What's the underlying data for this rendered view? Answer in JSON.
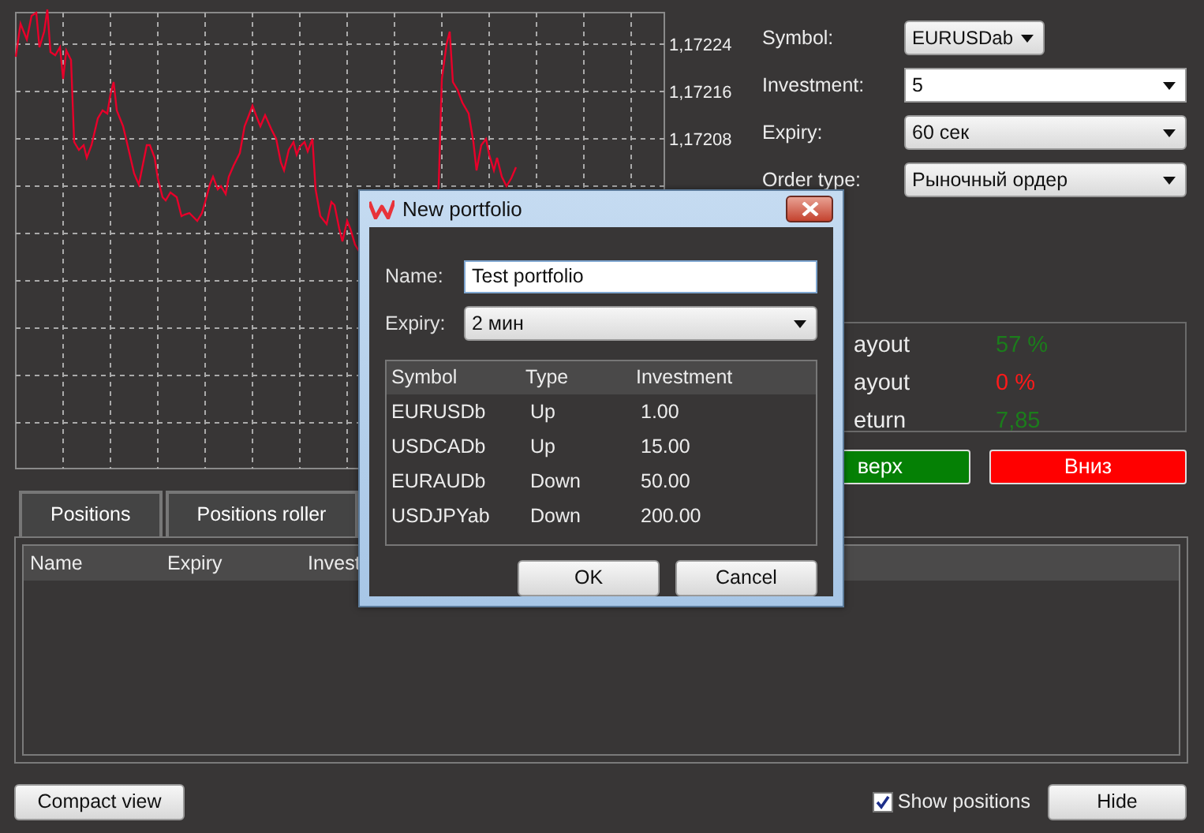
{
  "chart": {
    "price_labels": [
      "1,17224",
      "1,17216",
      "1,17208"
    ]
  },
  "order_form": {
    "fields": [
      {
        "label": "Symbol:",
        "value": "EURUSDab",
        "kind": "picker"
      },
      {
        "label": "Investment:",
        "value": "5",
        "kind": "combo"
      },
      {
        "label": "Expiry:",
        "value": "60 сек",
        "kind": "dropdown"
      },
      {
        "label": "Order type:",
        "value": "Рыночный ордер",
        "kind": "dropdown"
      }
    ]
  },
  "stats": [
    {
      "label": "ayout",
      "value": "57 %",
      "color": "#1b7d1b"
    },
    {
      "label": "ayout",
      "value": "0 %",
      "color": "#ff1a1a"
    },
    {
      "label": "eturn",
      "value": "7,85",
      "color": "#1b7d1b"
    }
  ],
  "trade_buttons": [
    {
      "label": "верх",
      "kind": "up"
    },
    {
      "label": "Вниз",
      "kind": "down"
    }
  ],
  "bottom_tabs": [
    "Positions",
    "Positions roller"
  ],
  "positions_table": {
    "columns": [
      "Name",
      "Expiry",
      "Invest"
    ]
  },
  "compact_view_button": "Compact view",
  "show_positions": {
    "label": "Show positions",
    "checked": true
  },
  "hide_button": "Hide",
  "dialog": {
    "title": "New portfolio",
    "name_label": "Name:",
    "name_value": "Test portfolio",
    "expiry_label": "Expiry:",
    "expiry_value": "2 мин",
    "table": {
      "columns": [
        "Symbol",
        "Type",
        "Investment"
      ],
      "rows": [
        [
          "EURUSDb",
          "Up",
          "1.00"
        ],
        [
          "USDCADb",
          "Up",
          "15.00"
        ],
        [
          "EURAUDb",
          "Down",
          "50.00"
        ],
        [
          "USDJPYab",
          "Down",
          "200.00"
        ]
      ]
    },
    "buttons": [
      "OK",
      "Cancel"
    ]
  }
}
